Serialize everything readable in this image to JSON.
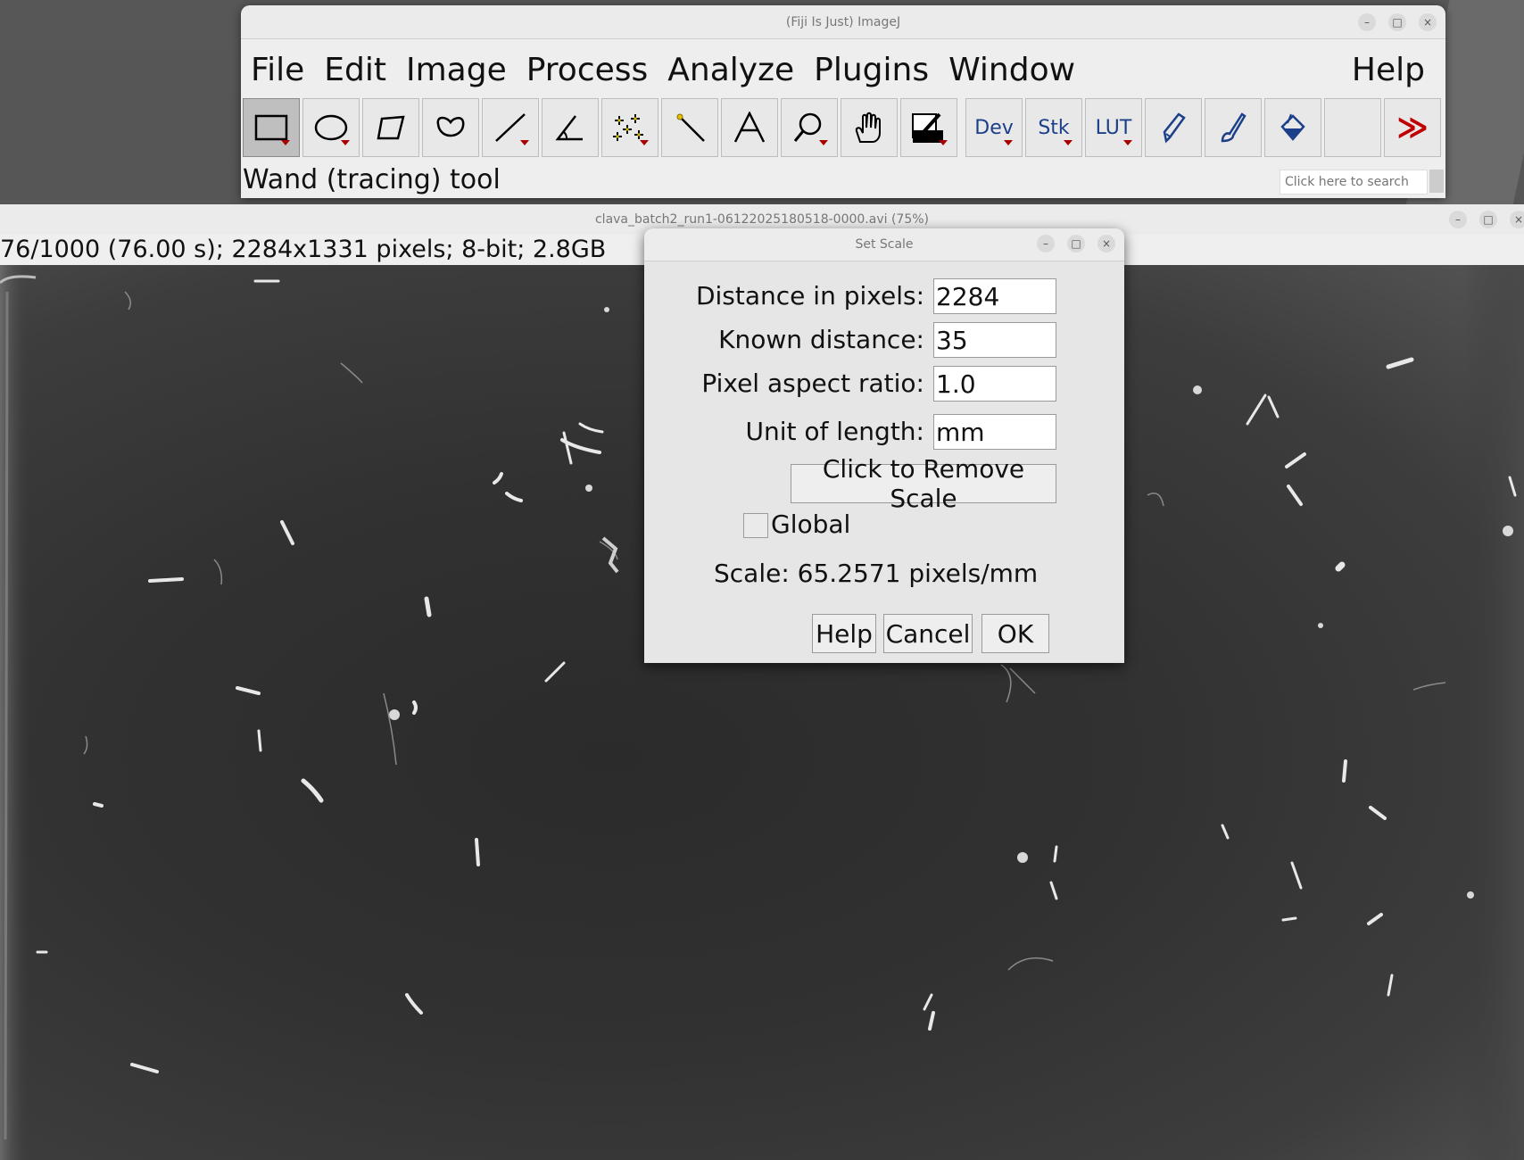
{
  "fiji": {
    "title": "(Fiji Is Just) ImageJ",
    "menu": [
      "File",
      "Edit",
      "Image",
      "Process",
      "Analyze",
      "Plugins",
      "Window"
    ],
    "help_menu": "Help",
    "tools": {
      "dev": "Dev",
      "stk": "Stk",
      "lut": "LUT",
      "more": "≫"
    },
    "status": "Wand (tracing) tool",
    "search_placeholder": "Click here to search"
  },
  "image_window": {
    "title": "clava_batch2_run1-06122025180518-0000.avi (75%)",
    "info": "76/1000 (76.00 s); 2284x1331 pixels; 8-bit; 2.8GB"
  },
  "dialog": {
    "title": "Set Scale",
    "fields": [
      {
        "label": "Distance in pixels:",
        "value": "2284"
      },
      {
        "label": "Known distance:",
        "value": "35"
      },
      {
        "label": "Pixel aspect ratio:",
        "value": "1.0"
      },
      {
        "label": "Unit of length:",
        "value": "mm"
      }
    ],
    "remove_scale": "Click to Remove Scale",
    "global_label": "Global",
    "global_checked": false,
    "scale_text": "Scale: 65.2571 pixels/mm",
    "buttons": {
      "help": "Help",
      "cancel": "Cancel",
      "ok": "OK"
    }
  },
  "window_controls": {
    "minimize": "–",
    "maximize": "□",
    "close": "×"
  }
}
